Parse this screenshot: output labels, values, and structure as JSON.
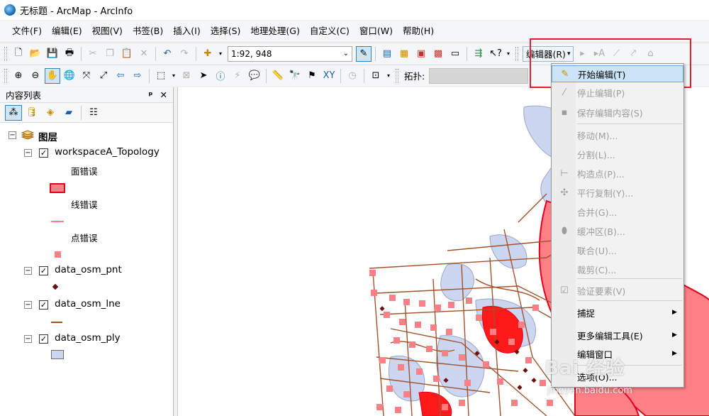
{
  "window": {
    "title": "无标题 - ArcMap - ArcInfo"
  },
  "menubar": {
    "items": [
      "文件(F)",
      "编辑(E)",
      "视图(V)",
      "书签(B)",
      "插入(I)",
      "选择(S)",
      "地理处理(G)",
      "自定义(C)",
      "窗口(W)",
      "帮助(H)"
    ]
  },
  "toolbar": {
    "scale_value": "1:92, 948",
    "editor_label": "编辑器(R)",
    "topology_label": "拓扑:"
  },
  "toc": {
    "title": "内容列表",
    "pin": "ᵖ",
    "close": "✕",
    "root_label": "图层",
    "layers": [
      {
        "name": "workspaceA_Topology",
        "legend": [
          "面错误",
          "线错误",
          "点错误"
        ]
      },
      {
        "name": "data_osm_pnt"
      },
      {
        "name": "data_osm_lne"
      },
      {
        "name": "data_osm_ply"
      }
    ]
  },
  "editor_menu": {
    "items": [
      {
        "label": "开始编辑(T)",
        "state": "hover"
      },
      {
        "label": "停止编辑(P)",
        "state": "disabled"
      },
      {
        "label": "保存编辑内容(S)",
        "state": "disabled"
      },
      {
        "label": "移动(M)...",
        "state": "disabled"
      },
      {
        "label": "分割(L)...",
        "state": "disabled"
      },
      {
        "label": "构造点(P)...",
        "state": "disabled"
      },
      {
        "label": "平行复制(Y)...",
        "state": "disabled"
      },
      {
        "label": "合并(G)...",
        "state": "disabled"
      },
      {
        "label": "缓冲区(B)...",
        "state": "disabled"
      },
      {
        "label": "联合(U)...",
        "state": "disabled"
      },
      {
        "label": "裁剪(C)...",
        "state": "disabled"
      },
      {
        "label": "验证要素(V)",
        "state": "disabled"
      },
      {
        "label": "捕捉",
        "state": "enabled",
        "submenu": true
      },
      {
        "label": "更多编辑工具(E)",
        "state": "enabled",
        "submenu": true
      },
      {
        "label": "编辑窗口",
        "state": "enabled",
        "submenu": true
      },
      {
        "label": "选项(O)...",
        "state": "enabled"
      }
    ]
  },
  "colors": {
    "error_fill": "#ff7f86",
    "error_stroke": "#e3001b",
    "polygon_fill": "#ccd6f0",
    "line_color": "#a0522d",
    "point_color": "#6b1010",
    "highlight": "#e0202a"
  },
  "watermark": {
    "text": "Bai 经验",
    "sub": "jingyan.baidu.com"
  }
}
